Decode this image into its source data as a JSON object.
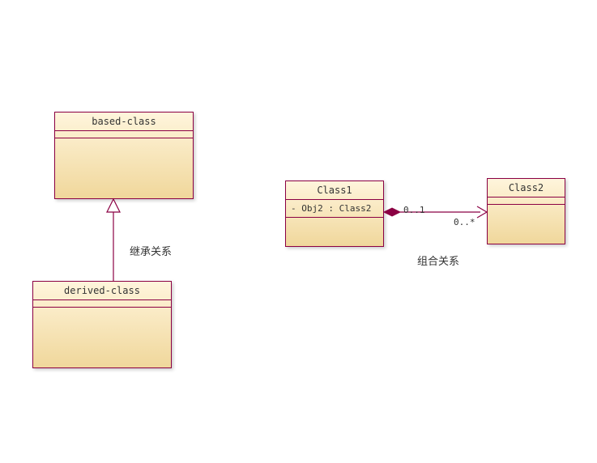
{
  "classes": {
    "based": {
      "name": "based-class"
    },
    "derived": {
      "name": "derived-class"
    },
    "class1": {
      "name": "Class1",
      "attr": "-  Obj2  : Class2"
    },
    "class2": {
      "name": "Class2"
    }
  },
  "labels": {
    "inheritance": "继承关系",
    "composition": "组合关系"
  },
  "multiplicities": {
    "left": "0..1",
    "right": "0..*"
  }
}
